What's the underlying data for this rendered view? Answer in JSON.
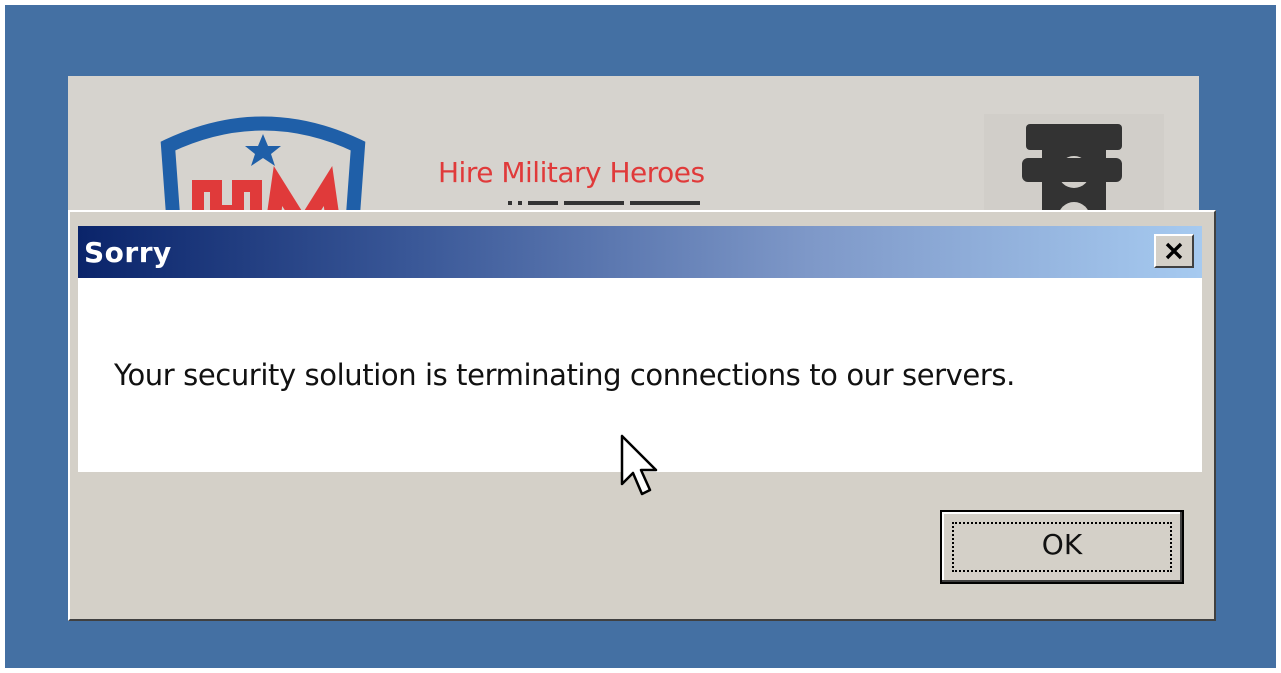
{
  "background_app": {
    "title": "Hire Military Heroes",
    "logo_icon": "hm-shield-logo-icon",
    "right_icon": "traffic-light-icon",
    "brand_color": "#e03a3a"
  },
  "dialog": {
    "title": "Sorry",
    "message": "Your security solution is terminating connections to our servers.",
    "ok_label": "OK",
    "close_icon": "close-icon",
    "titlebar_colors": [
      "#0a246a",
      "#a6caf0"
    ]
  },
  "cursor": {
    "icon": "mouse-pointer-icon"
  }
}
